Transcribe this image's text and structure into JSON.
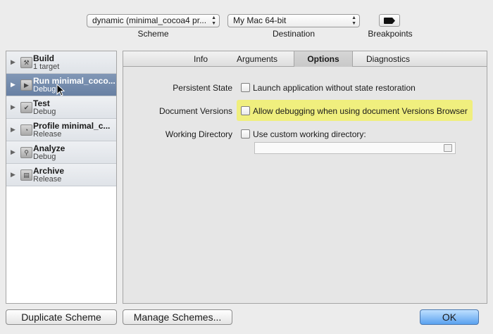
{
  "toolbar": {
    "scheme_value": "dynamic (minimal_cocoa4 pr...",
    "scheme_label": "Scheme",
    "destination_value": "My Mac 64-bit",
    "destination_label": "Destination",
    "breakpoints_label": "Breakpoints"
  },
  "sidebar": {
    "items": [
      {
        "title": "Build",
        "sub": "1 target",
        "icon": "hammer-icon"
      },
      {
        "title": "Run minimal_coco...",
        "sub": "Debug",
        "icon": "run-icon"
      },
      {
        "title": "Test",
        "sub": "Debug",
        "icon": "test-icon"
      },
      {
        "title": "Profile minimal_c...",
        "sub": "Release",
        "icon": "profile-icon"
      },
      {
        "title": "Analyze",
        "sub": "Debug",
        "icon": "analyze-icon"
      },
      {
        "title": "Archive",
        "sub": "Release",
        "icon": "archive-icon"
      }
    ],
    "selected": "Run minimal_coco..."
  },
  "tabs": [
    "Info",
    "Arguments",
    "Options",
    "Diagnostics"
  ],
  "active_tab": "Options",
  "options": {
    "persistent_state": {
      "label": "Persistent State",
      "checkbox_text": "Launch application without state restoration",
      "checked": false
    },
    "document_versions": {
      "label": "Document Versions",
      "checkbox_text": "Allow debugging when using document Versions Browser",
      "checked": false
    },
    "working_directory": {
      "label": "Working Directory",
      "checkbox_text": "Use custom working directory:",
      "checked": false,
      "path_value": ""
    }
  },
  "buttons": {
    "duplicate": "Duplicate Scheme",
    "manage": "Manage Schemes...",
    "ok": "OK"
  },
  "colors": {
    "highlight": "#f0ef7e",
    "selection": "#7288aa",
    "ok_button": "#5aa1ef"
  }
}
